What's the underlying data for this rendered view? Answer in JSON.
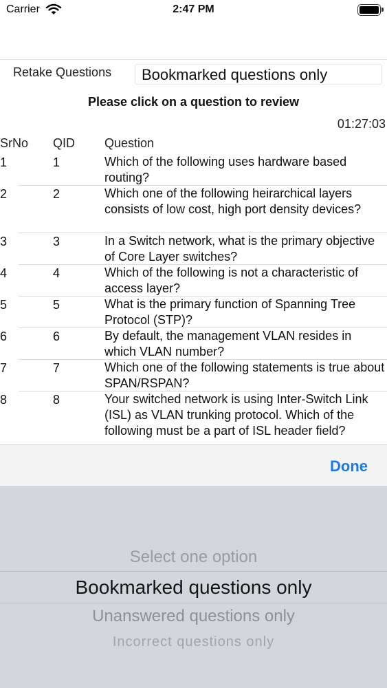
{
  "status_bar": {
    "carrier": "Carrier",
    "time": "2:47 PM",
    "wifi_icon": "wifi-icon",
    "battery_icon": "battery-icon"
  },
  "header": {
    "retake_label": "Retake Questions",
    "filter_value": "Bookmarked questions only"
  },
  "instruction": "Please click on a question to review",
  "timer": "01:27:03",
  "table": {
    "columns": [
      "SrNo",
      "QID",
      "Question"
    ],
    "rows": [
      {
        "srno": "1",
        "qid": "1",
        "question": "Which of the following uses hardware based routing?"
      },
      {
        "srno": "2",
        "qid": "2",
        "question": "Which one of the following heirarchical layers consists of  low cost, high port density devices?"
      },
      {
        "srno": "3",
        "qid": "3",
        "question": "In a Switch network, what is the primary objective of Core Layer switches?"
      },
      {
        "srno": "4",
        "qid": "4",
        "question": "Which of the following is not a characteristic of access layer?"
      },
      {
        "srno": "5",
        "qid": "5",
        "question": "What is the primary function of Spanning Tree Protocol (STP)?"
      },
      {
        "srno": "6",
        "qid": "6",
        "question": "By default, the management VLAN resides in which VLAN number?"
      },
      {
        "srno": "7",
        "qid": "7",
        "question": "Which one of the following statements is true about SPAN/RSPAN?"
      },
      {
        "srno": "8",
        "qid": "8",
        "question": "Your switched network is using Inter-Switch Link (ISL) as VLAN trunking protocol. Which of the following must be a part of ISL header field?"
      }
    ]
  },
  "picker": {
    "done_label": "Done",
    "options": [
      "Select one option",
      "Bookmarked questions only",
      "Unanswered questions only",
      "Incorrect questions only"
    ],
    "selected": "Bookmarked questions only"
  },
  "colors": {
    "accent": "#1a7ae6",
    "picker_background": "#d3d6dc"
  }
}
